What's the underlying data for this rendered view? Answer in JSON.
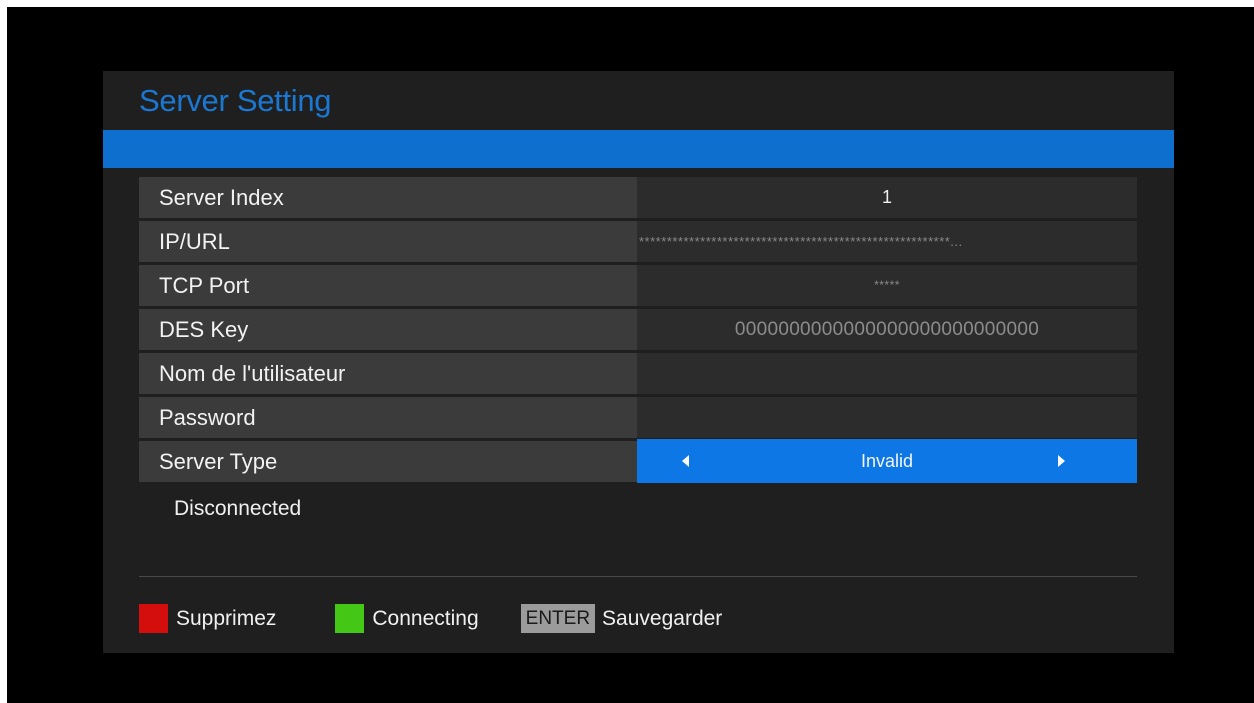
{
  "header": {
    "title": "Server Setting"
  },
  "colors": {
    "accent": "#0e6fcf",
    "selected": "#0e77e6",
    "red_key": "#d40d0d",
    "green_key": "#44c815"
  },
  "rows": [
    {
      "label": "Server Index",
      "value": "1"
    },
    {
      "label": "IP/URL",
      "value": "********************************************************..."
    },
    {
      "label": "TCP Port",
      "value": "*****"
    },
    {
      "label": "DES Key",
      "value": "0000000000000000000000000000"
    },
    {
      "label": "Nom de l'utilisateur",
      "value": ""
    },
    {
      "label": "Password",
      "value": ""
    },
    {
      "label": "Server Type",
      "value": "Invalid"
    }
  ],
  "status": "Disconnected",
  "footer": {
    "red_label": "Supprimez",
    "green_label": "Connecting",
    "enter_key": "ENTER",
    "enter_label": "Sauvegarder"
  }
}
